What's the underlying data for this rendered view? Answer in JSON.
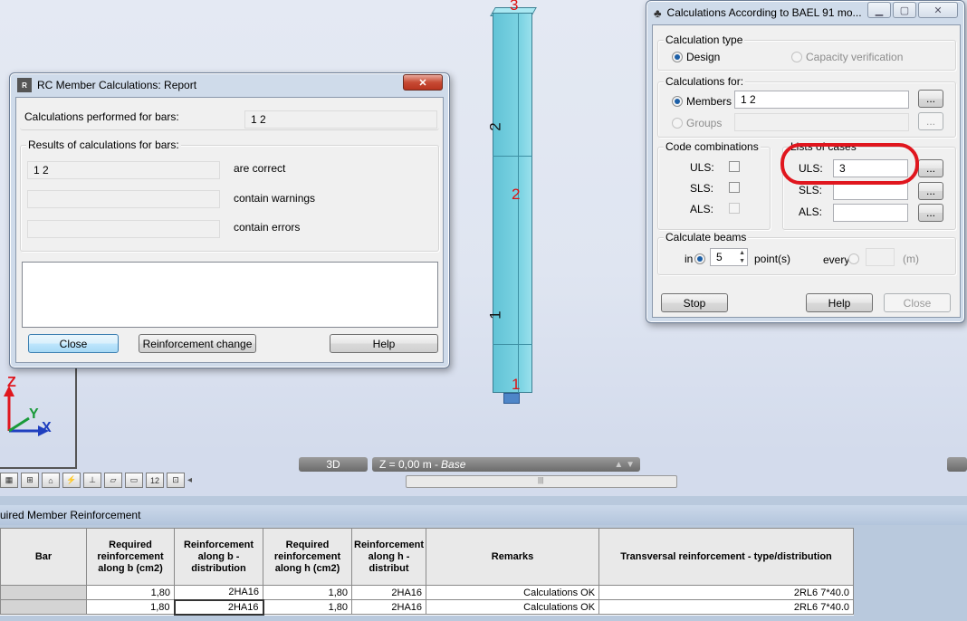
{
  "view": {
    "node_labels": [
      "3",
      "2",
      "1"
    ],
    "bar_labels": [
      "2",
      "1"
    ],
    "axes": {
      "z": "Z",
      "y": "Y",
      "x": "X"
    },
    "mode_label": "3D",
    "level_label": "Z = 0,00 m - ",
    "level_name": "Base"
  },
  "report_dialog": {
    "title": "RC Member Calculations: Report",
    "performed_label": "Calculations performed for bars:",
    "performed_value": "1 2",
    "results_group": "Results of calculations for bars:",
    "correct_value": "1 2",
    "correct_label": "are correct",
    "warnings_value": "",
    "warnings_label": "contain warnings",
    "errors_value": "",
    "errors_label": "contain errors",
    "buttons": {
      "close": "Close",
      "reinforcement": "Reinforcement change",
      "help": "Help"
    }
  },
  "bael_dialog": {
    "title": "Calculations According to BAEL 91 mo...",
    "calc_type_group": "Calculation type",
    "design_label": "Design",
    "capacity_label": "Capacity verification",
    "calc_for_group": "Calculations for:",
    "members_label": "Members",
    "members_value": "1 2",
    "groups_label": "Groups",
    "groups_value": "",
    "browse_label": "...",
    "code_comb_group": "Code combinations",
    "uls_label": "ULS:",
    "sls_label": "SLS:",
    "als_label": "ALS:",
    "lists_group": "Lists of cases",
    "lists_uls_value": "3",
    "lists_sls_value": "",
    "lists_als_value": "",
    "beams_group": "Calculate beams",
    "in_label": "in",
    "points_value": "5",
    "points_label": "point(s)",
    "every_label": "every",
    "every_value": "",
    "unit_label": "(m)",
    "buttons": {
      "stop": "Stop",
      "help": "Help",
      "close": "Close"
    }
  },
  "table": {
    "title": "uired Member Reinforcement",
    "columns": [
      "Bar",
      "Required reinforcement along b (cm2)",
      "Reinforcement along b - distribution",
      "Required reinforcement along h (cm2)",
      "Reinforcement along h - distribut",
      "Remarks",
      "Transversal reinforcement - type/distribution"
    ],
    "rows": [
      [
        "",
        "1,80",
        "2HA16",
        "1,80",
        "2HA16",
        "Calculations OK",
        "2RL6 7*40.0"
      ],
      [
        "",
        "1,80",
        "2HA16",
        "1,80",
        "2HA16",
        "Calculations OK",
        "2RL6 7*40.0"
      ]
    ]
  },
  "colors": {
    "highlight": "#e0161e",
    "accent": "#1c5fa7"
  }
}
